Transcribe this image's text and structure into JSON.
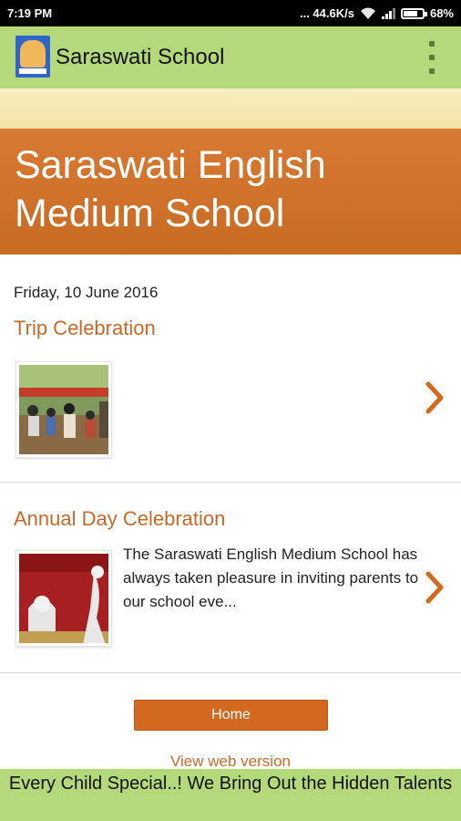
{
  "status_bar": {
    "time": "7:19 PM",
    "network_speed": "... 44.6K/s",
    "battery_percent": "68%",
    "battery_level": 0.68,
    "icons": [
      "wifi-icon",
      "signal-icon",
      "battery-icon"
    ]
  },
  "app_bar": {
    "title": "Saraswati School",
    "logo_icon": "saraswati-logo-icon",
    "menu_icon": "overflow-menu-icon",
    "color": "#b3d97a"
  },
  "header": {
    "site_title": "Saraswati English Medium School",
    "banner_color": "#d07428"
  },
  "posts": {
    "date": "Friday, 10 June 2016",
    "items": [
      {
        "title": "Trip Celebration",
        "snippet": ""
      },
      {
        "title": "Annual Day Celebration",
        "snippet": "The Saraswati English Medium School has always taken pleasure in inviting parents to our school eve..."
      }
    ],
    "title_color": "#c8692a"
  },
  "footer": {
    "home_label": "Home",
    "view_web_label": "View web version",
    "banner_text": "Every Child Special..! We Bring Out the Hidden Talents",
    "button_color": "#d2691f"
  }
}
